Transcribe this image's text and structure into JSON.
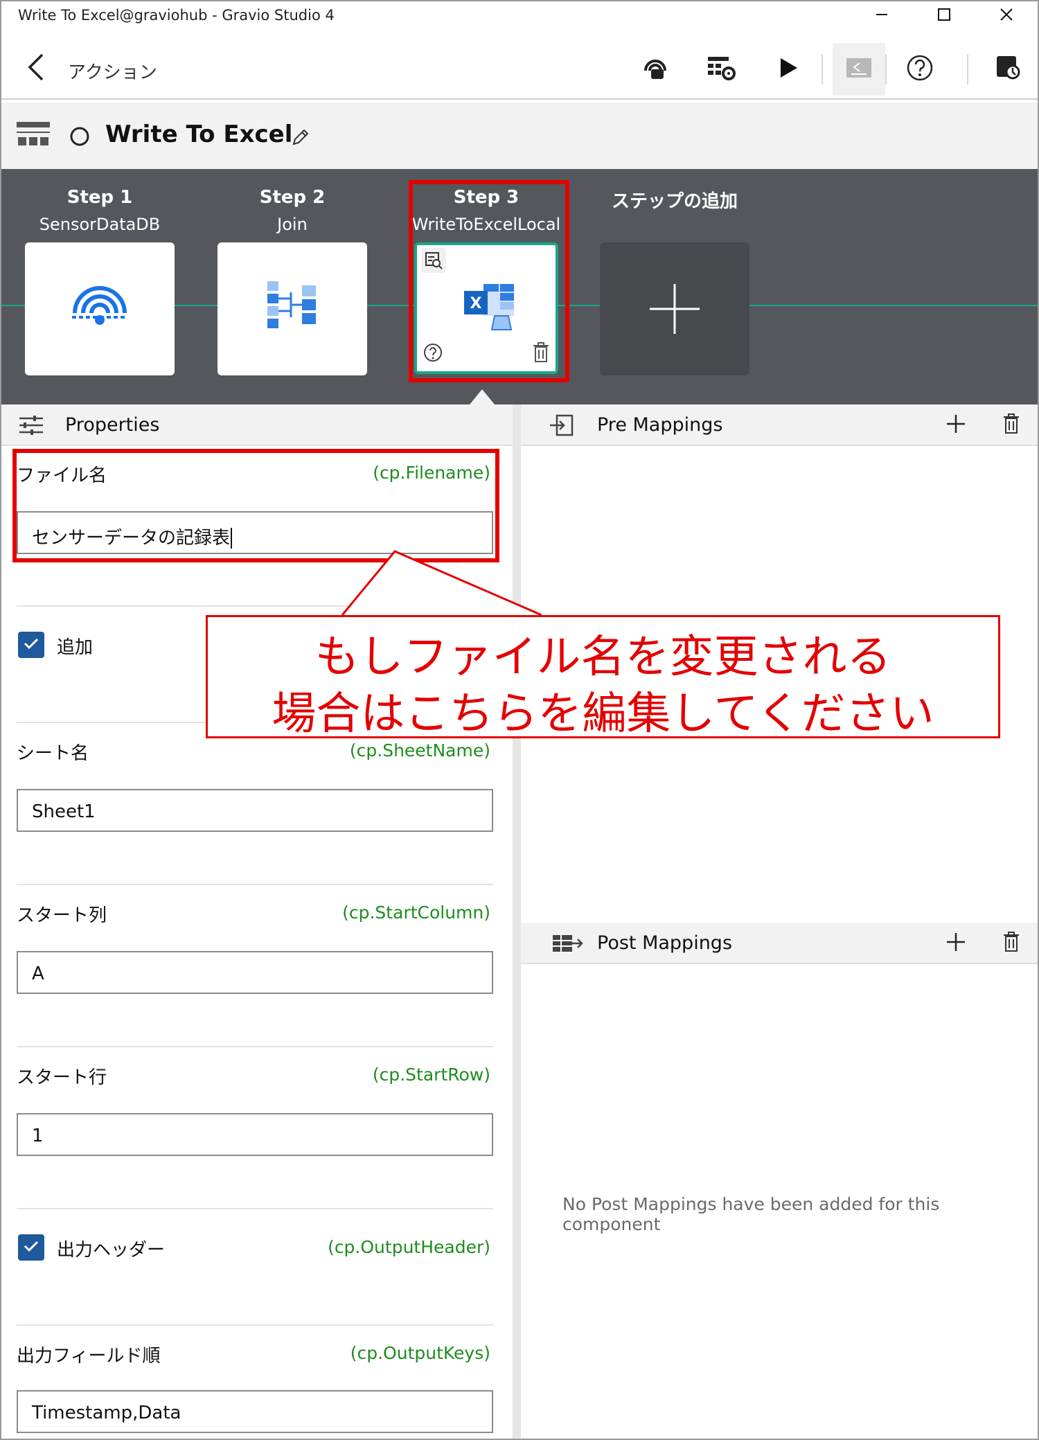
{
  "window": {
    "title": "Write To Excel@graviohub - Gravio Studio 4",
    "controls": [
      "minimize-icon",
      "maximize-icon",
      "close-icon"
    ]
  },
  "appbar": {
    "title": "アクション",
    "icons": [
      "back-chevron-icon",
      "hub-sensor-icon",
      "action-settings-icon",
      "play-icon",
      "terminal-icon",
      "help-icon",
      "sync-icon"
    ]
  },
  "action": {
    "name": "Write To Excel"
  },
  "steps": [
    {
      "title": "Step 1",
      "name": "SensorDataDB",
      "icon": "sensor-data-icon"
    },
    {
      "title": "Step 2",
      "name": "Join",
      "icon": "join-icon"
    },
    {
      "title": "Step 3",
      "name": "WriteToExcelLocal",
      "icon": "excel-icon"
    },
    {
      "title": "ステップの追加",
      "name": "",
      "icon": "plus-icon"
    }
  ],
  "properties": {
    "header": "Properties",
    "fields": {
      "filename": {
        "label": "ファイル名",
        "cp": "(cp.Filename)",
        "value": "センサーデータの記録表"
      },
      "append": {
        "label": "追加",
        "checked": true
      },
      "sheet": {
        "label": "シート名",
        "cp": "(cp.SheetName)",
        "value": "Sheet1"
      },
      "start_column": {
        "label": "スタート列",
        "cp": "(cp.StartColumn)",
        "value": "A"
      },
      "start_row": {
        "label": "スタート行",
        "cp": "(cp.StartRow)",
        "value": "1"
      },
      "output_header": {
        "label": "出力ヘッダー",
        "cp": "(cp.OutputHeader)",
        "checked": true
      },
      "output_keys": {
        "label": "出力フィールド順",
        "cp": "(cp.OutputKeys)",
        "value": "Timestamp,Data"
      }
    }
  },
  "pre_mappings": {
    "header": "Pre Mappings"
  },
  "post_mappings": {
    "header": "Post Mappings",
    "empty": "No Post Mappings have been added for this component"
  },
  "callout": {
    "line1": "もしファイル名を変更される",
    "line2": "場合はこちらを編集してください"
  },
  "colors": {
    "annotation_red": "#e30000",
    "step_band": "#54585d",
    "accent_green": "#1aa58a",
    "cp_green": "#1e8c1e",
    "checkbox_blue": "#1e5a9c",
    "icon_blue": "#1a73e8"
  }
}
